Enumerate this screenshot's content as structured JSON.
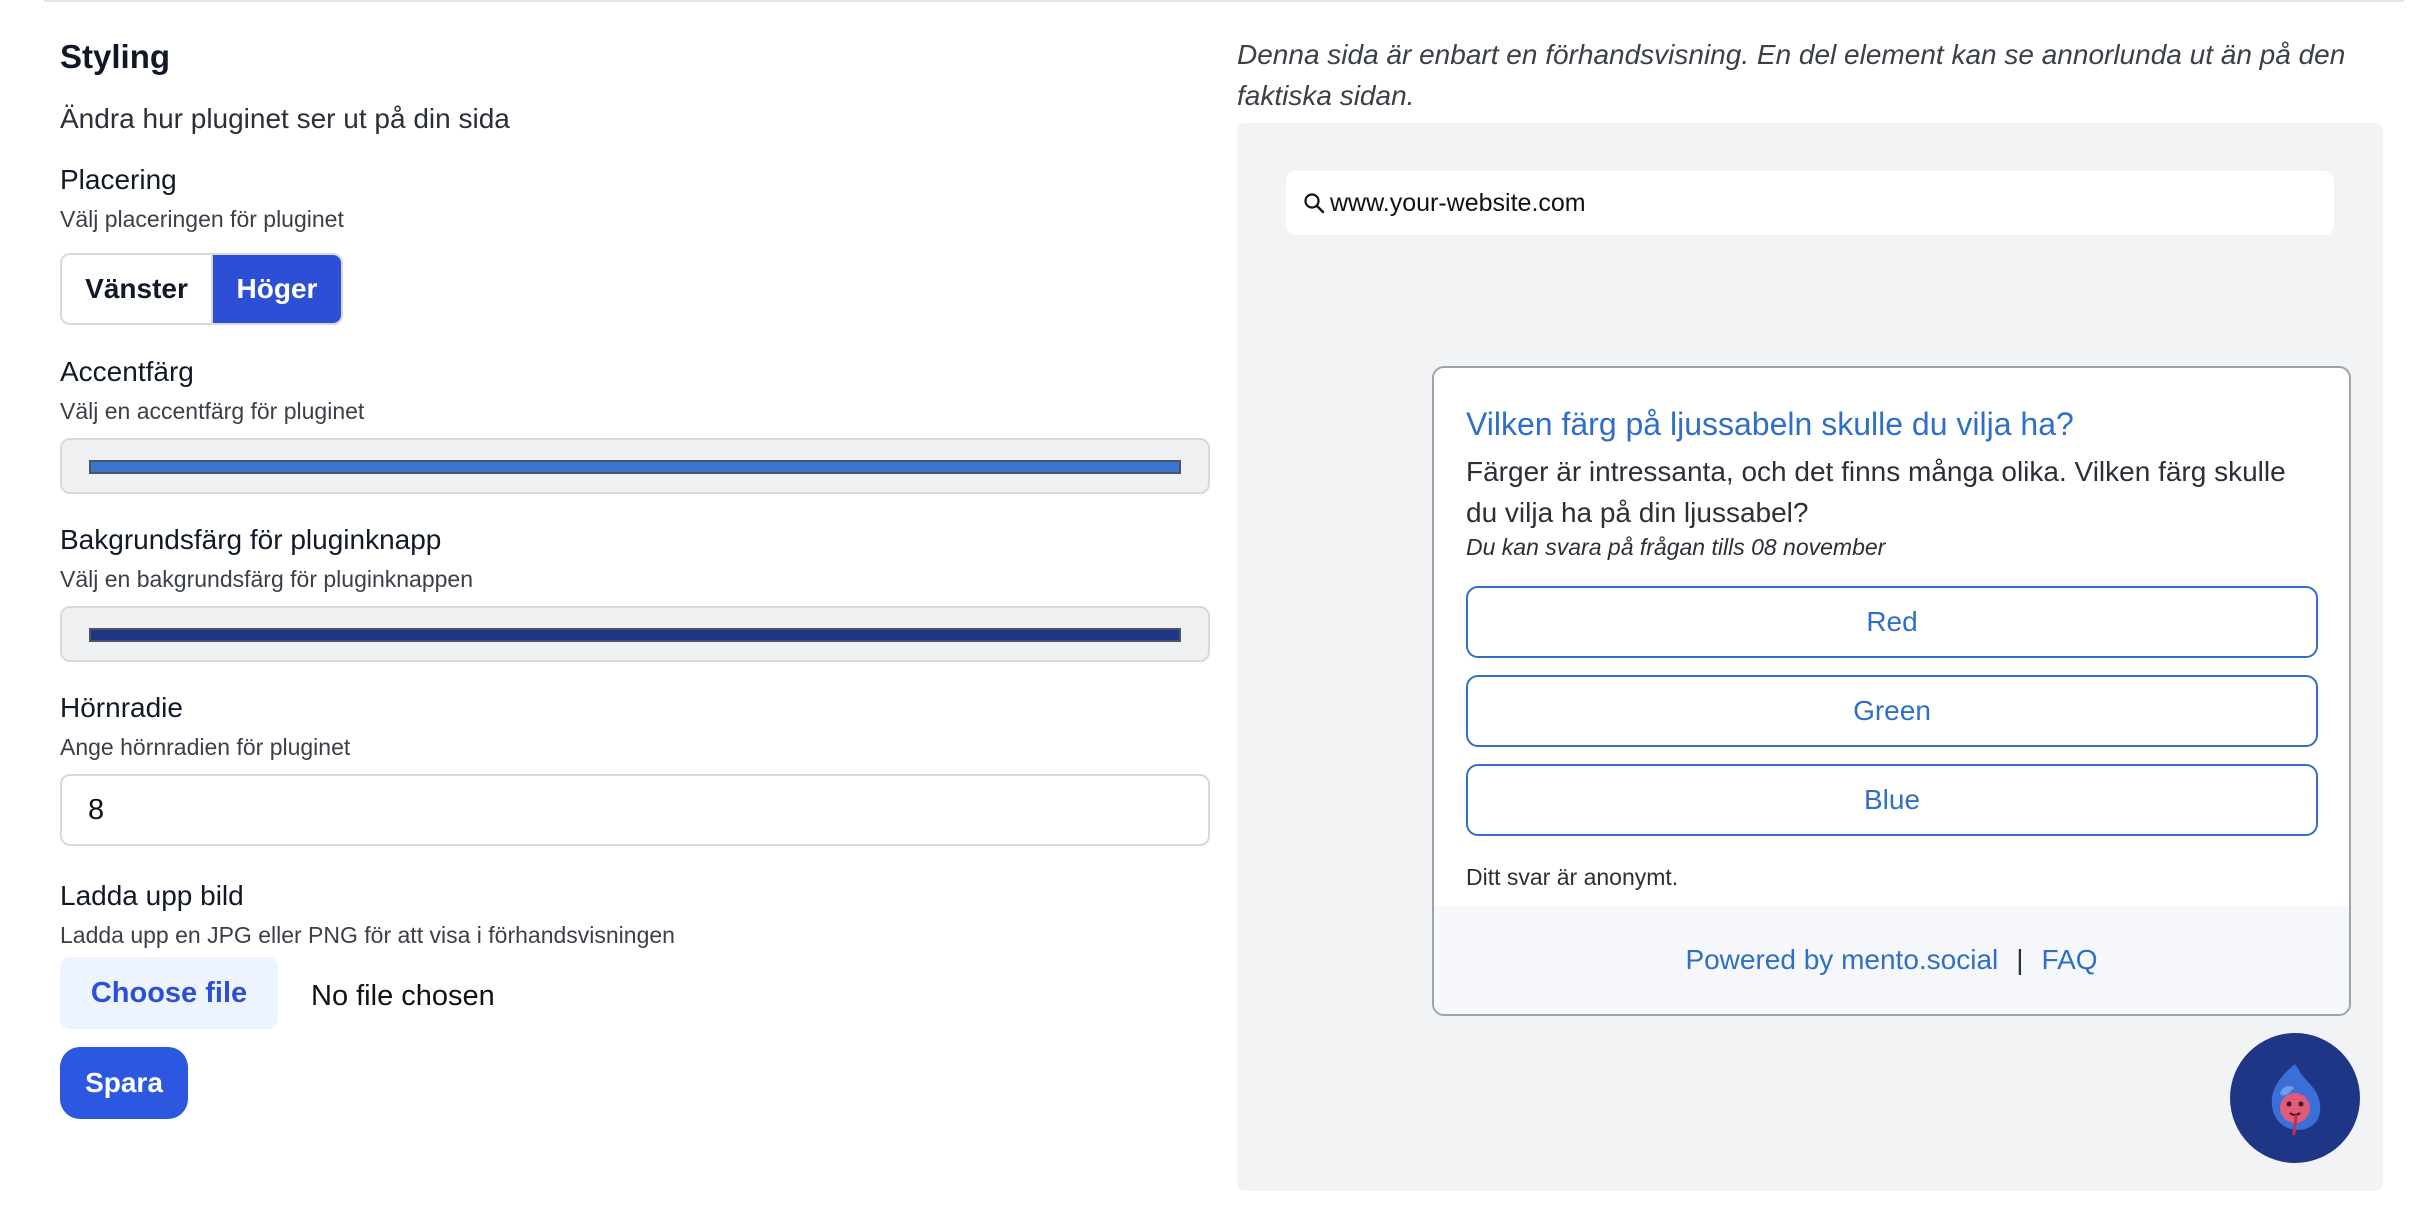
{
  "styling": {
    "title": "Styling",
    "subtitle": "Ändra hur pluginet ser ut på din sida"
  },
  "placement": {
    "label": "Placering",
    "help": "Välj placeringen för pluginet",
    "options": [
      "Vänster",
      "Höger"
    ],
    "selected": "Höger"
  },
  "accent": {
    "label": "Accentfärg",
    "help": "Välj en accentfärg för pluginet",
    "color": "#3b74d1"
  },
  "button_bg": {
    "label": "Bakgrundsfärg för pluginknapp",
    "help": "Välj en bakgrundsfärg för pluginknappen",
    "color": "#1f3585"
  },
  "radius": {
    "label": "Hörnradie",
    "help": "Ange hörnradien för pluginet",
    "value": "8"
  },
  "upload": {
    "label": "Ladda upp bild",
    "help": "Ladda upp en JPG eller PNG för att visa i förhandsvisningen",
    "button": "Choose file",
    "status": "No file chosen"
  },
  "save_label": "Spara",
  "preview": {
    "notice": "Denna sida är enbart en förhandsvisning. En del element kan se annorlunda ut än på den faktiska sidan.",
    "url": "www.your-website.com",
    "question": "Vilken färg på ljussabeln skulle du vilja ha?",
    "description": "Färger är intressanta, och det finns många olika. Vilken färg skulle du vilja ha på din ljussabel?",
    "deadline": "Du kan svara på frågan tills 08 november",
    "options": [
      "Red",
      "Green",
      "Blue"
    ],
    "anonymous": "Ditt svar är anonymt.",
    "powered_by": "Powered by mento.social",
    "separator": "|",
    "faq": "FAQ"
  },
  "icons": {
    "search": "search-icon",
    "fab": "mascot-icon"
  },
  "colors": {
    "primary": "#2c4fd6",
    "link": "#2f6fc7",
    "fab": "#1f3585"
  }
}
